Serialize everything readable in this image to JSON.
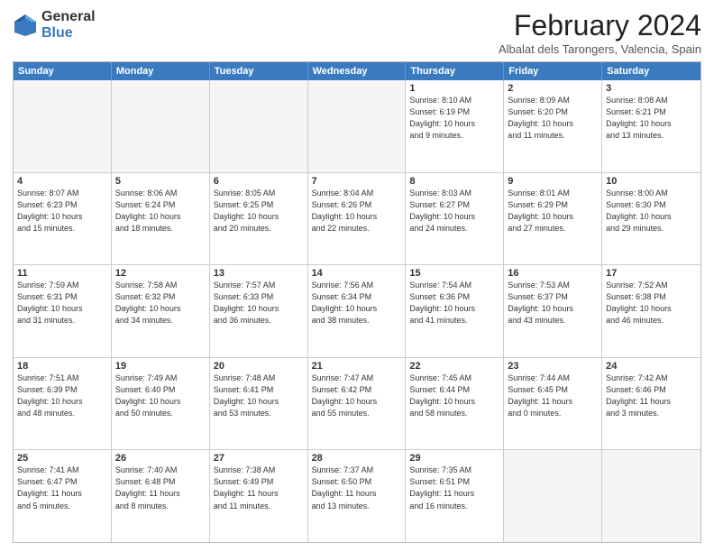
{
  "logo": {
    "general": "General",
    "blue": "Blue"
  },
  "title": "February 2024",
  "subtitle": "Albalat dels Tarongers, Valencia, Spain",
  "headers": [
    "Sunday",
    "Monday",
    "Tuesday",
    "Wednesday",
    "Thursday",
    "Friday",
    "Saturday"
  ],
  "weeks": [
    [
      {
        "num": "",
        "info": "",
        "empty": true
      },
      {
        "num": "",
        "info": "",
        "empty": true
      },
      {
        "num": "",
        "info": "",
        "empty": true
      },
      {
        "num": "",
        "info": "",
        "empty": true
      },
      {
        "num": "1",
        "info": "Sunrise: 8:10 AM\nSunset: 6:19 PM\nDaylight: 10 hours\nand 9 minutes."
      },
      {
        "num": "2",
        "info": "Sunrise: 8:09 AM\nSunset: 6:20 PM\nDaylight: 10 hours\nand 11 minutes."
      },
      {
        "num": "3",
        "info": "Sunrise: 8:08 AM\nSunset: 6:21 PM\nDaylight: 10 hours\nand 13 minutes."
      }
    ],
    [
      {
        "num": "4",
        "info": "Sunrise: 8:07 AM\nSunset: 6:23 PM\nDaylight: 10 hours\nand 15 minutes."
      },
      {
        "num": "5",
        "info": "Sunrise: 8:06 AM\nSunset: 6:24 PM\nDaylight: 10 hours\nand 18 minutes."
      },
      {
        "num": "6",
        "info": "Sunrise: 8:05 AM\nSunset: 6:25 PM\nDaylight: 10 hours\nand 20 minutes."
      },
      {
        "num": "7",
        "info": "Sunrise: 8:04 AM\nSunset: 6:26 PM\nDaylight: 10 hours\nand 22 minutes."
      },
      {
        "num": "8",
        "info": "Sunrise: 8:03 AM\nSunset: 6:27 PM\nDaylight: 10 hours\nand 24 minutes."
      },
      {
        "num": "9",
        "info": "Sunrise: 8:01 AM\nSunset: 6:29 PM\nDaylight: 10 hours\nand 27 minutes."
      },
      {
        "num": "10",
        "info": "Sunrise: 8:00 AM\nSunset: 6:30 PM\nDaylight: 10 hours\nand 29 minutes."
      }
    ],
    [
      {
        "num": "11",
        "info": "Sunrise: 7:59 AM\nSunset: 6:31 PM\nDaylight: 10 hours\nand 31 minutes."
      },
      {
        "num": "12",
        "info": "Sunrise: 7:58 AM\nSunset: 6:32 PM\nDaylight: 10 hours\nand 34 minutes."
      },
      {
        "num": "13",
        "info": "Sunrise: 7:57 AM\nSunset: 6:33 PM\nDaylight: 10 hours\nand 36 minutes."
      },
      {
        "num": "14",
        "info": "Sunrise: 7:56 AM\nSunset: 6:34 PM\nDaylight: 10 hours\nand 38 minutes."
      },
      {
        "num": "15",
        "info": "Sunrise: 7:54 AM\nSunset: 6:36 PM\nDaylight: 10 hours\nand 41 minutes."
      },
      {
        "num": "16",
        "info": "Sunrise: 7:53 AM\nSunset: 6:37 PM\nDaylight: 10 hours\nand 43 minutes."
      },
      {
        "num": "17",
        "info": "Sunrise: 7:52 AM\nSunset: 6:38 PM\nDaylight: 10 hours\nand 46 minutes."
      }
    ],
    [
      {
        "num": "18",
        "info": "Sunrise: 7:51 AM\nSunset: 6:39 PM\nDaylight: 10 hours\nand 48 minutes."
      },
      {
        "num": "19",
        "info": "Sunrise: 7:49 AM\nSunset: 6:40 PM\nDaylight: 10 hours\nand 50 minutes."
      },
      {
        "num": "20",
        "info": "Sunrise: 7:48 AM\nSunset: 6:41 PM\nDaylight: 10 hours\nand 53 minutes."
      },
      {
        "num": "21",
        "info": "Sunrise: 7:47 AM\nSunset: 6:42 PM\nDaylight: 10 hours\nand 55 minutes."
      },
      {
        "num": "22",
        "info": "Sunrise: 7:45 AM\nSunset: 6:44 PM\nDaylight: 10 hours\nand 58 minutes."
      },
      {
        "num": "23",
        "info": "Sunrise: 7:44 AM\nSunset: 6:45 PM\nDaylight: 11 hours\nand 0 minutes."
      },
      {
        "num": "24",
        "info": "Sunrise: 7:42 AM\nSunset: 6:46 PM\nDaylight: 11 hours\nand 3 minutes."
      }
    ],
    [
      {
        "num": "25",
        "info": "Sunrise: 7:41 AM\nSunset: 6:47 PM\nDaylight: 11 hours\nand 5 minutes."
      },
      {
        "num": "26",
        "info": "Sunrise: 7:40 AM\nSunset: 6:48 PM\nDaylight: 11 hours\nand 8 minutes."
      },
      {
        "num": "27",
        "info": "Sunrise: 7:38 AM\nSunset: 6:49 PM\nDaylight: 11 hours\nand 11 minutes."
      },
      {
        "num": "28",
        "info": "Sunrise: 7:37 AM\nSunset: 6:50 PM\nDaylight: 11 hours\nand 13 minutes."
      },
      {
        "num": "29",
        "info": "Sunrise: 7:35 AM\nSunset: 6:51 PM\nDaylight: 11 hours\nand 16 minutes."
      },
      {
        "num": "",
        "info": "",
        "empty": true
      },
      {
        "num": "",
        "info": "",
        "empty": true
      }
    ]
  ]
}
